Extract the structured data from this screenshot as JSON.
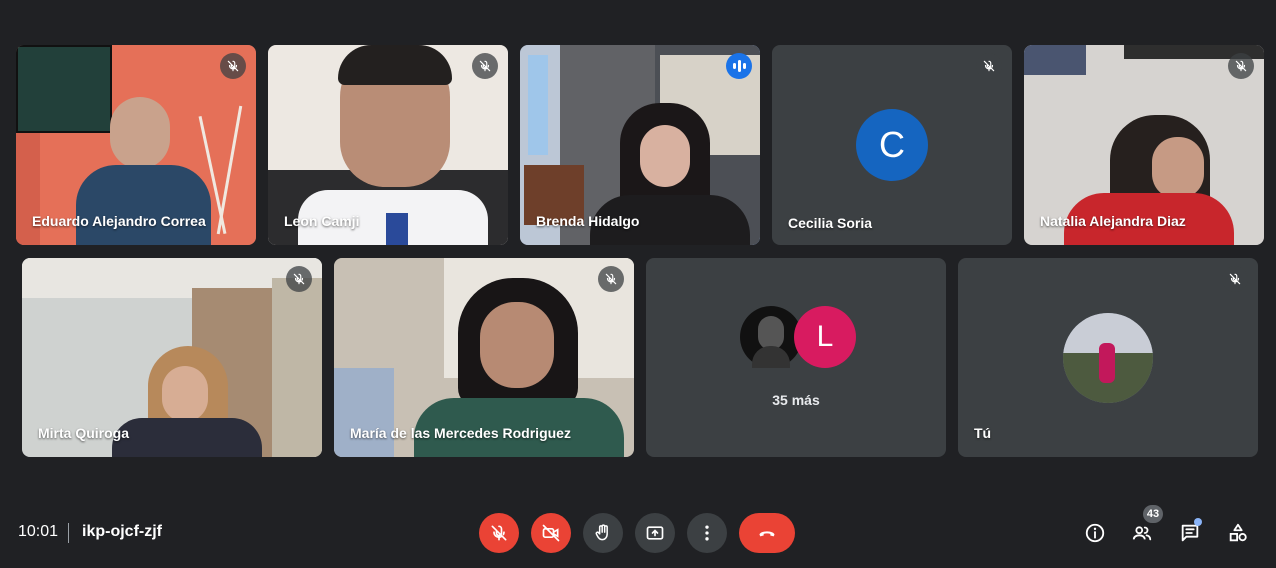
{
  "participants": [
    {
      "name": "Eduardo Alejandro Correa",
      "muted": true
    },
    {
      "name": "Leon Camji",
      "muted": true
    },
    {
      "name": "Brenda Hidalgo",
      "speaking": true
    },
    {
      "name": "Cecilia Soria",
      "muted": true,
      "avatar_letter": "C",
      "avatar_color": "#1565c0"
    },
    {
      "name": "Natalia Alejandra Diaz",
      "muted": true
    },
    {
      "name": "Mirta Quiroga",
      "muted": true
    },
    {
      "name": "María de las Mercedes Rodriguez",
      "muted": true
    },
    {
      "name": "Tú",
      "muted": true
    }
  ],
  "others": {
    "label": "35 más",
    "avatar_letter": "L",
    "avatar_color": "#d81b60"
  },
  "bottom_bar": {
    "time": "10:01",
    "meeting_code": "ikp-ojcf-zjf",
    "participants_count": "43",
    "controls": [
      "mic-off-icon",
      "camera-off-icon",
      "raise-hand-icon",
      "present-screen-icon",
      "more-options-icon",
      "end-call-icon"
    ],
    "right_icons": [
      "info-icon",
      "people-icon",
      "chat-icon",
      "activities-icon"
    ]
  },
  "colors": {
    "background": "#202124",
    "tile": "#3c4043",
    "active_outline": "#8ab4f8",
    "end_call": "#ea4335",
    "speaking": "#1a73e8"
  }
}
